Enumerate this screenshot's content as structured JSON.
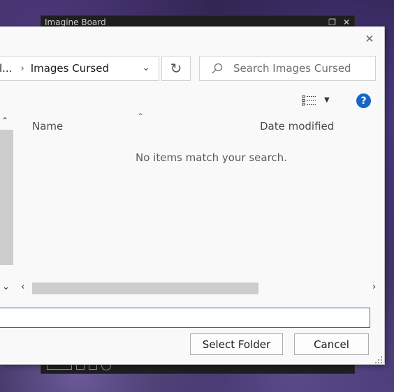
{
  "background_app": {
    "title": "Imagine Board",
    "restore_glyph": "❐",
    "close_glyph": "✕"
  },
  "dialog": {
    "close_glyph": "✕",
    "breadcrumb": {
      "previous": "l...",
      "separator": "›",
      "current": "Images Cursed",
      "dropdown_glyph": "⌄"
    },
    "refresh_glyph": "↻",
    "search": {
      "placeholder": "Search Images Cursed",
      "value": ""
    },
    "view_dropdown_glyph": "▼",
    "help_label": "?",
    "nav": {
      "up_glyph": "⌃",
      "expand_glyph": "⌄"
    },
    "columns": {
      "sort_glyph": "⌃",
      "name": "Name",
      "date_modified": "Date modified"
    },
    "empty_message": "No items match your search.",
    "hscroll": {
      "left_glyph": "‹",
      "right_glyph": "›"
    },
    "folder_input": {
      "value": ""
    },
    "buttons": {
      "select_folder": "Select Folder",
      "cancel": "Cancel"
    }
  },
  "colors": {
    "accent": "#1766c5",
    "input_border_focus": "#2f6d9a"
  }
}
